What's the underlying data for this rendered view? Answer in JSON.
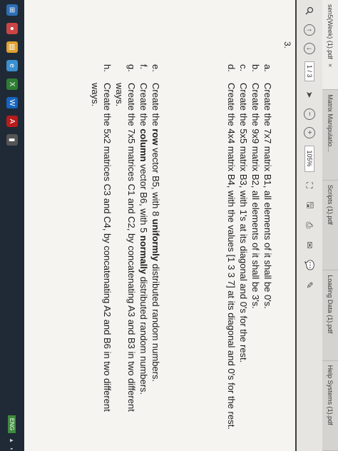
{
  "tabs": [
    {
      "label": "sen5(Week) (1).pdf",
      "close": "×"
    },
    {
      "label": "Matrix Manipulatio..."
    },
    {
      "label": "Scripts (1).pdf"
    },
    {
      "label": "Loading Data (1).pdf"
    },
    {
      "label": "Help Systems (1).pdf"
    }
  ],
  "toolbar": {
    "page": "1 / 3",
    "zoom": "105%"
  },
  "document": {
    "question_number": "3.",
    "items_top": [
      {
        "label": "a.",
        "text": "Create the 7x7 matrix B1, all elements of it shall be 0's."
      },
      {
        "label": "b.",
        "text": "Create the 9x9 matrix B2, all elements of it shall be 3's."
      },
      {
        "label": "c.",
        "text": "Create the 5x5 matrix B3, with 1's at its diagonal and 0's for the rest."
      },
      {
        "label": "d.",
        "text": "Create the 4x4 matrix B4, with the values [1 3 3 7] at its diagonal and 0's for the rest."
      }
    ],
    "items_bottom": [
      {
        "label": "e.",
        "pre": "Create the ",
        "bold": "row",
        "mid": " vector B5, with 8 ",
        "bold2": "uniformly",
        "post": " distributed random numbers."
      },
      {
        "label": "f.",
        "pre": "Create the ",
        "bold": "column",
        "mid": " vector B6, with 5 ",
        "bold2": "normally",
        "post": " distributed random numbers."
      },
      {
        "label": "g.",
        "text": "Create the 7x5 matrices C1 and C2, by concatenating A3 and B3 in two different ways."
      },
      {
        "label": "h.",
        "text": "Create the 5x2 matrices C3 and C4, by concatenating A2 and B6 in two different ways."
      }
    ]
  },
  "taskbar": {
    "tray_badge": "ENG"
  }
}
